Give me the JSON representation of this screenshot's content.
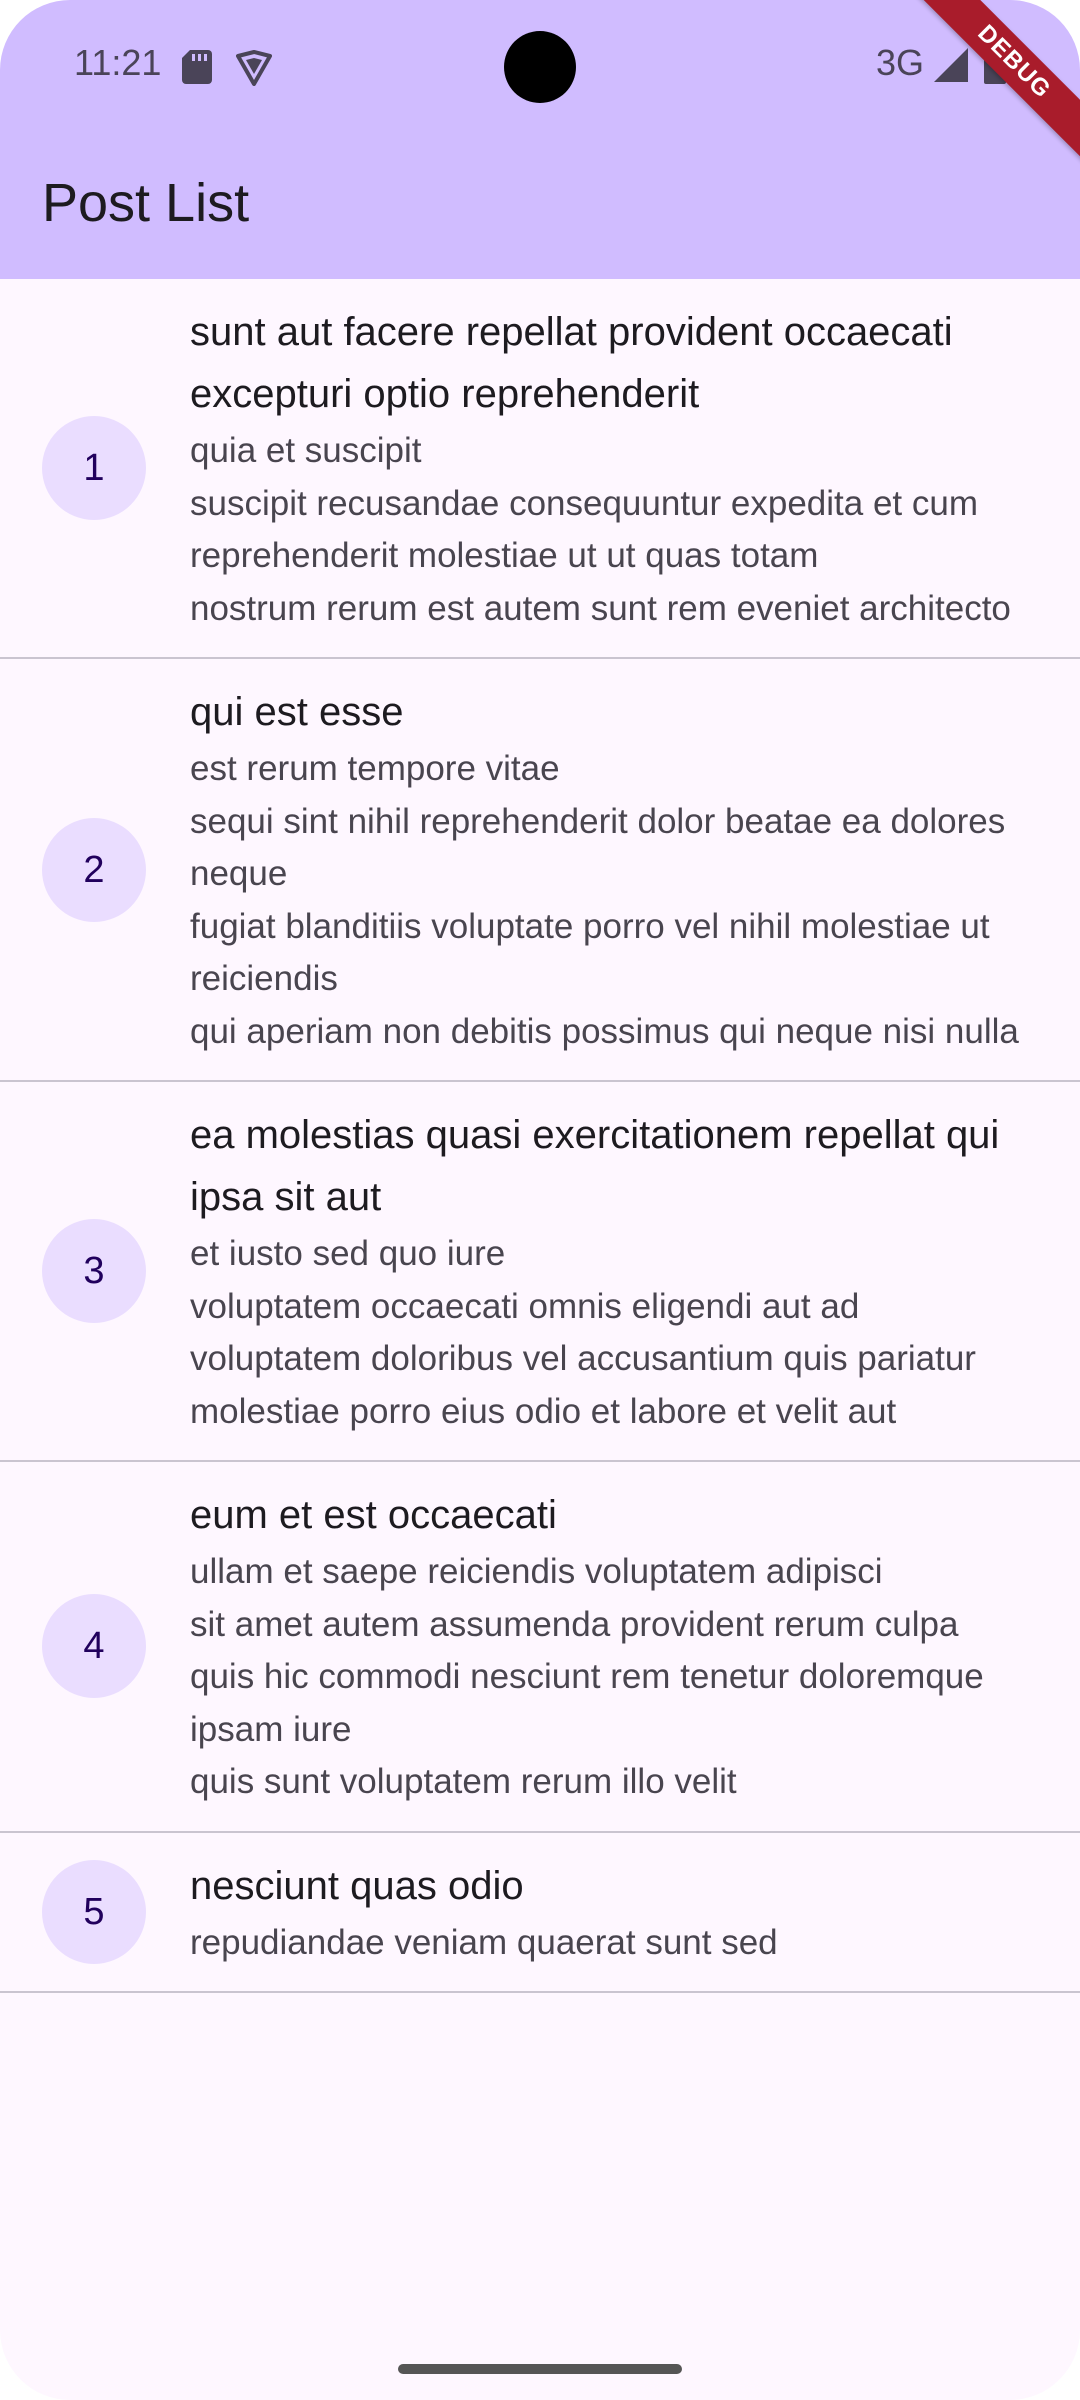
{
  "status_bar": {
    "time": "11:21",
    "network": "3G",
    "icons": [
      "sd-card-icon",
      "vpn-shield-icon",
      "signal-icon",
      "battery-icon"
    ]
  },
  "debug_banner": "DEBUG",
  "app_bar": {
    "title": "Post List"
  },
  "colors": {
    "app_bar": "#d0bcff",
    "background": "#fef7ff",
    "avatar": "#eaddff",
    "debug": "#a91c2b"
  },
  "posts": [
    {
      "number": "1",
      "title": "sunt aut facere repellat provident occaecati excepturi optio reprehenderit",
      "body": "quia et suscipit\nsuscipit recusandae consequuntur expedita et cum\nreprehenderit molestiae ut ut quas totam\nnostrum rerum est autem sunt rem eveniet architecto"
    },
    {
      "number": "2",
      "title": "qui est esse",
      "body": "est rerum tempore vitae\nsequi sint nihil reprehenderit dolor beatae ea dolores neque\nfugiat blanditiis voluptate porro vel nihil molestiae ut reiciendis\nqui aperiam non debitis possimus qui neque nisi nulla"
    },
    {
      "number": "3",
      "title": "ea molestias quasi exercitationem repellat qui ipsa sit aut",
      "body": "et iusto sed quo iure\nvoluptatem occaecati omnis eligendi aut ad\nvoluptatem doloribus vel accusantium quis pariatur\nmolestiae porro eius odio et labore et velit aut"
    },
    {
      "number": "4",
      "title": "eum et est occaecati",
      "body": "ullam et saepe reiciendis voluptatem adipisci\nsit amet autem assumenda provident rerum culpa\nquis hic commodi nesciunt rem tenetur doloremque ipsam iure\nquis sunt voluptatem rerum illo velit"
    },
    {
      "number": "5",
      "title": "nesciunt quas odio",
      "body": "repudiandae veniam quaerat sunt sed"
    }
  ]
}
